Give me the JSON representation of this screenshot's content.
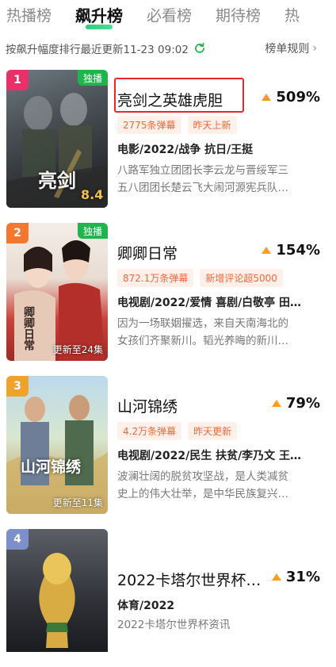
{
  "tabs": [
    {
      "label": "热播榜",
      "active": false
    },
    {
      "label": "飙升榜",
      "active": true
    },
    {
      "label": "必看榜",
      "active": false
    },
    {
      "label": "期待榜",
      "active": false
    },
    {
      "label": "热",
      "active": false
    }
  ],
  "subheader": {
    "description": "按飙升幅度排行最近更新11-23 09:02",
    "rules_label": "榜单规则",
    "refresh_icon": "refresh-icon",
    "refresh_color": "#1fb54c"
  },
  "colors": {
    "accent_green": "#1fb54c",
    "rank1": "#e8306a",
    "rank2": "#f4772f",
    "rank3": "#f0a32a",
    "rank4": "#7e90c9",
    "tag_text": "#ef6a3c",
    "highlight_border": "#e8262b",
    "rise_triangle": "#ff9d1e"
  },
  "items": [
    {
      "rank": "1",
      "exclusive": "独播",
      "poster_text": "亮剑",
      "poster_score": "8.4",
      "title": "亮剑之英雄虎胆",
      "rise": "509%",
      "tags": [
        "2775条弹幕",
        "昨天上新"
      ],
      "meta": "电影/2022/战争 抗日/王挺",
      "summary_line1": "八路军独立团团长李云龙与晋绥军三",
      "summary_line2": "五八团团长楚云飞大闹河源宪兵队…"
    },
    {
      "rank": "2",
      "exclusive": "独播",
      "poster_text": "卿卿日常",
      "update": "更新至24集",
      "title": "卿卿日常",
      "rise": "154%",
      "tags": [
        "872.1万条弹幕",
        "新增评论超5000"
      ],
      "meta": "电视剧/2022/爱情 喜剧/白敬亭 田…",
      "summary_line1": "因为一场联姻擢选，来自天南海北的",
      "summary_line2": "女孩们齐聚新川。韬光养晦的新川…"
    },
    {
      "rank": "3",
      "poster_text": "山河锦绣",
      "update": "更新至11集",
      "title": "山河锦绣",
      "rise": "79%",
      "tags": [
        "4.2万条弹幕",
        "昨天更新"
      ],
      "meta": "电视剧/2022/民生 扶贫/李乃文 王…",
      "summary_line1": "波澜壮阔的脱贫攻坚战，是人类减贫",
      "summary_line2": "史上的伟大壮举，是中华民族复兴…"
    },
    {
      "rank": "4",
      "title": "2022卡塔尔世界杯…",
      "rise": "31%",
      "meta": "体育/2022",
      "summary_line1": "2022卡塔尔世界杯资讯"
    }
  ]
}
